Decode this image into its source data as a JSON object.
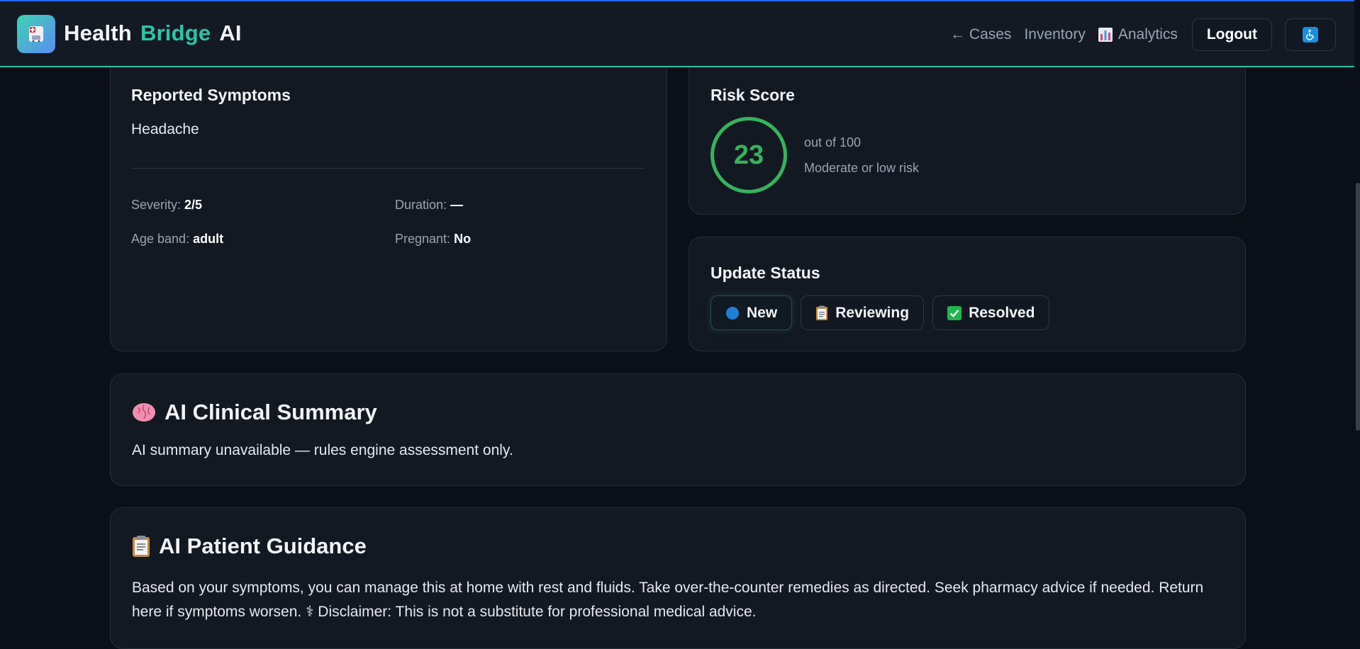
{
  "app": {
    "brand_part1": "Health",
    "brand_part2": "Bridge",
    "brand_part3": "AI",
    "accent_color": "#2bc4a7"
  },
  "nav": {
    "cases_label": "← Cases",
    "inventory_label": "Inventory",
    "analytics_label": "Analytics",
    "logout_label": "Logout",
    "accessibility_icon": "wheelchair-icon"
  },
  "symptoms": {
    "title": "Reported Symptoms",
    "value": "Headache",
    "severity_label": "Severity:",
    "severity_value": "2/5",
    "duration_label": "Duration:",
    "duration_value": "—",
    "age_label": "Age band:",
    "age_value": "adult",
    "pregnant_label": "Pregnant:",
    "pregnant_value": "No"
  },
  "risk": {
    "title": "Risk Score",
    "score": "23",
    "out_of": "out of 100",
    "level": "Moderate or low risk",
    "color": "#34b45a"
  },
  "status": {
    "title": "Update Status",
    "options": [
      {
        "label": "New",
        "icon": "blue-circle-icon",
        "active": true
      },
      {
        "label": "Reviewing",
        "icon": "clipboard-icon",
        "active": false
      },
      {
        "label": "Resolved",
        "icon": "check-box-icon",
        "active": false
      }
    ]
  },
  "summary": {
    "title": "AI Clinical Summary",
    "icon": "brain-icon",
    "text": "AI summary unavailable — rules engine assessment only."
  },
  "guidance": {
    "title": "AI Patient Guidance",
    "icon": "clipboard-icon",
    "text": "Based on your symptoms, you can manage this at home with rest and fluids. Take over-the-counter remedies as directed. Seek pharmacy advice if needed. Return here if symptoms worsen. ⚕ Disclaimer: This is not a substitute for professional medical advice."
  }
}
